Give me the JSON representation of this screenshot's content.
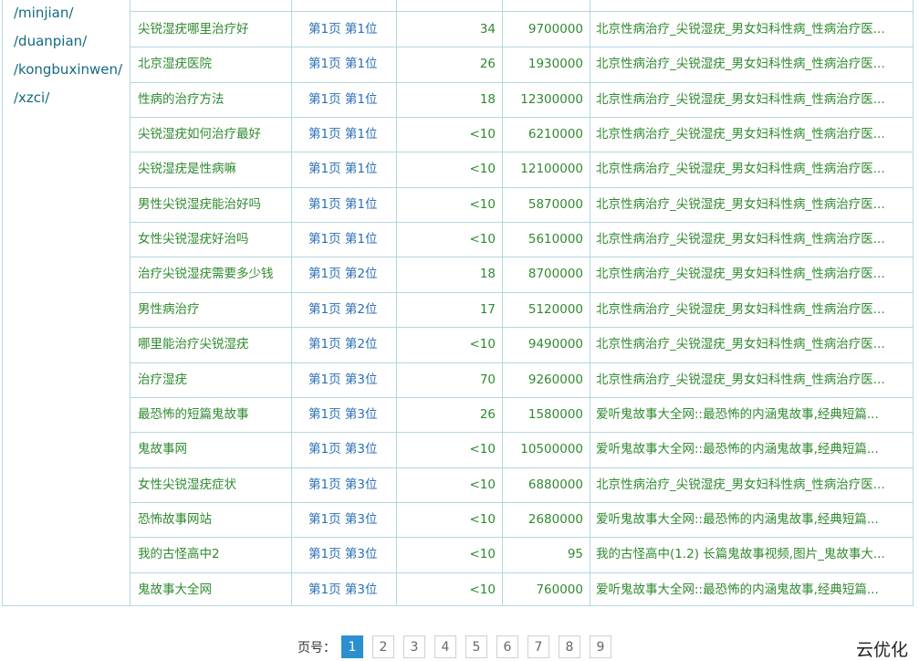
{
  "sidebar": {
    "paths": [
      "/minjian/",
      "/duanpian/",
      "/kongbuxinwen/",
      "/xzci/"
    ]
  },
  "table": {
    "rows": [
      {
        "keyword": "尖锐湿疣哪里治疗好",
        "rank": "第1页 第1位",
        "index": "34",
        "volume": "9700000",
        "title": "北京性病治疗_尖锐湿疣_男女妇科性病_性病治疗医..."
      },
      {
        "keyword": "北京湿疣医院",
        "rank": "第1页 第1位",
        "index": "26",
        "volume": "1930000",
        "title": "北京性病治疗_尖锐湿疣_男女妇科性病_性病治疗医..."
      },
      {
        "keyword": "性病的治疗方法",
        "rank": "第1页 第1位",
        "index": "18",
        "volume": "12300000",
        "title": "北京性病治疗_尖锐湿疣_男女妇科性病_性病治疗医..."
      },
      {
        "keyword": "尖锐湿疣如何治疗最好",
        "rank": "第1页 第1位",
        "index": "<10",
        "volume": "6210000",
        "title": "北京性病治疗_尖锐湿疣_男女妇科性病_性病治疗医..."
      },
      {
        "keyword": "尖锐湿疣是性病嘛",
        "rank": "第1页 第1位",
        "index": "<10",
        "volume": "12100000",
        "title": "北京性病治疗_尖锐湿疣_男女妇科性病_性病治疗医..."
      },
      {
        "keyword": "男性尖锐湿疣能治好吗",
        "rank": "第1页 第1位",
        "index": "<10",
        "volume": "5870000",
        "title": "北京性病治疗_尖锐湿疣_男女妇科性病_性病治疗医..."
      },
      {
        "keyword": "女性尖锐湿疣好治吗",
        "rank": "第1页 第1位",
        "index": "<10",
        "volume": "5610000",
        "title": "北京性病治疗_尖锐湿疣_男女妇科性病_性病治疗医..."
      },
      {
        "keyword": "治疗尖锐湿疣需要多少钱",
        "rank": "第1页 第2位",
        "index": "18",
        "volume": "8700000",
        "title": "北京性病治疗_尖锐湿疣_男女妇科性病_性病治疗医..."
      },
      {
        "keyword": "男性病治疗",
        "rank": "第1页 第2位",
        "index": "17",
        "volume": "5120000",
        "title": "北京性病治疗_尖锐湿疣_男女妇科性病_性病治疗医..."
      },
      {
        "keyword": "哪里能治疗尖锐湿疣",
        "rank": "第1页 第2位",
        "index": "<10",
        "volume": "9490000",
        "title": "北京性病治疗_尖锐湿疣_男女妇科性病_性病治疗医..."
      },
      {
        "keyword": "治疗湿疣",
        "rank": "第1页 第3位",
        "index": "70",
        "volume": "9260000",
        "title": "北京性病治疗_尖锐湿疣_男女妇科性病_性病治疗医..."
      },
      {
        "keyword": "最恐怖的短篇鬼故事",
        "rank": "第1页 第3位",
        "index": "26",
        "volume": "1580000",
        "title": "爱听鬼故事大全网::最恐怖的内涵鬼故事,经典短篇..."
      },
      {
        "keyword": "鬼故事网",
        "rank": "第1页 第3位",
        "index": "<10",
        "volume": "10500000",
        "title": "爱听鬼故事大全网::最恐怖的内涵鬼故事,经典短篇..."
      },
      {
        "keyword": "女性尖锐湿疣症状",
        "rank": "第1页 第3位",
        "index": "<10",
        "volume": "6880000",
        "title": "北京性病治疗_尖锐湿疣_男女妇科性病_性病治疗医..."
      },
      {
        "keyword": "恐怖故事网站",
        "rank": "第1页 第3位",
        "index": "<10",
        "volume": "2680000",
        "title": "爱听鬼故事大全网::最恐怖的内涵鬼故事,经典短篇..."
      },
      {
        "keyword": "我的古怪高中2",
        "rank": "第1页 第3位",
        "index": "<10",
        "volume": "95",
        "title": "我的古怪高中(1.2) 长篇鬼故事视频,图片_鬼故事大..."
      },
      {
        "keyword": "鬼故事大全网",
        "rank": "第1页 第3位",
        "index": "<10",
        "volume": "760000",
        "title": "爱听鬼故事大全网::最恐怖的内涵鬼故事,经典短篇..."
      }
    ]
  },
  "pagination": {
    "label": "页号：",
    "pages": [
      "1",
      "2",
      "3",
      "4",
      "5",
      "6",
      "7",
      "8",
      "9"
    ],
    "current": "1"
  },
  "watermark": "云优化",
  "colors": {
    "border": "#b5d6df",
    "link_green": "#2f8a2f",
    "rank_blue": "#2a6fb5",
    "active_page": "#2d8fd0"
  }
}
